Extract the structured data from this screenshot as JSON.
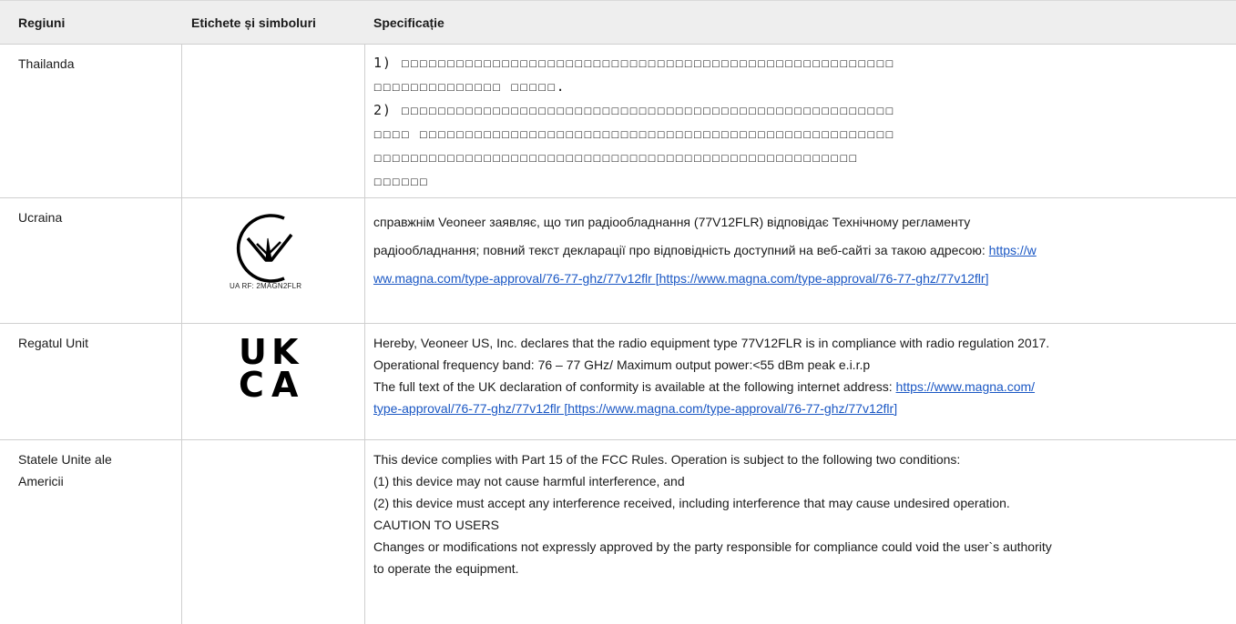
{
  "headers": {
    "region": "Regiuni",
    "symbols": "Etichete și simboluri",
    "spec": "Specificație"
  },
  "rows": [
    {
      "region": "Thailanda",
      "spec_lines": [
        "1) ☐☐☐☐☐☐☐☐☐☐☐☐☐☐☐☐☐☐☐☐☐☐☐☐☐☐☐☐☐☐☐☐☐☐☐☐☐☐☐☐☐☐☐☐☐☐☐☐☐☐☐☐☐☐",
        "☐☐☐☐☐☐☐☐☐☐☐☐☐☐ ☐☐☐☐☐.",
        "2) ☐☐☐☐☐☐☐☐☐☐☐☐☐☐☐☐☐☐☐☐☐☐☐☐☐☐☐☐☐☐☐☐☐☐☐☐☐☐☐☐☐☐☐☐☐☐☐☐☐☐☐☐☐☐",
        "☐☐☐☐ ☐☐☐☐☐☐☐☐☐☐☐☐☐☐☐☐☐☐☐☐☐☐☐☐☐☐☐☐☐☐☐☐☐☐☐☐☐☐☐☐☐☐☐☐☐☐☐☐☐☐☐☐",
        "☐☐☐☐☐☐☐☐☐☐☐☐☐☐☐☐☐☐☐☐☐☐☐☐☐☐☐☐☐☐☐☐☐☐☐☐☐☐☐☐☐☐☐☐☐☐☐☐☐☐☐☐☐",
        "☐☐☐☐☐☐"
      ]
    },
    {
      "region": "Ucraina",
      "symbol_caption": "UA RF: 2MAGN2FLR",
      "spec_line1": "справжнім Veoneer заявляє, що тип радіообладнання (77V12FLR) відповідає Технічному регламенту",
      "spec_line2_text": "радіообладнання; повний текст декларації про відповідність доступний на веб-сайті за такою адресою: ",
      "spec_line2_link": "https://w",
      "spec_line3_link": "ww.magna.com/type-approval/76-77-ghz/77v12flr [https://www.magna.com/type-approval/76-77-ghz/77v12flr]"
    },
    {
      "region": "Regatul Unit",
      "symbol_letters": [
        "U",
        "K",
        "C",
        "A"
      ],
      "spec_line1": "Hereby, Veoneer US, Inc. declares that the radio equipment type 77V12FLR is in compliance with radio regulation 2017.",
      "spec_line2": "Operational frequency band: 76 – 77 GHz/ Maximum output power:<55 dBm peak e.i.r.p",
      "spec_line3_text": "The full text of the UK declaration of conformity is available at the following internet address: ",
      "spec_line3_link": "https://www.magna.com/",
      "spec_line4_link": "type-approval/76-77-ghz/77v12flr [https://www.magna.com/type-approval/76-77-ghz/77v12flr]"
    },
    {
      "region": "Statele Unite ale Americii",
      "spec_lines": [
        "This device complies with Part 15 of the FCC Rules. Operation is subject to the following two conditions:",
        "(1) this device may not cause harmful interference, and",
        "(2) this device must accept any interference received, including interference that may cause undesired operation.",
        "CAUTION TO USERS",
        "Changes or modifications not expressly approved by the party responsible for compliance could void the user`s authority",
        "to operate the equipment."
      ]
    }
  ]
}
